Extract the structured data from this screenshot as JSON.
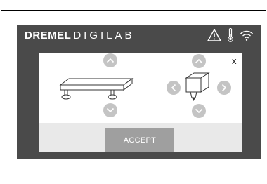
{
  "brand": {
    "bold": "DREMEL",
    "light": "DIGILAB"
  },
  "status_icons": [
    "warning-icon",
    "thermometer-icon",
    "wifi-icon"
  ],
  "dialog": {
    "close_label": "x",
    "accept_label": "ACCEPT",
    "bed_controls": [
      "arrow-up",
      "arrow-down"
    ],
    "extruder_controls": [
      "arrow-up",
      "arrow-down",
      "arrow-left",
      "arrow-right"
    ]
  },
  "colors": {
    "screen_bg": "#4a4a4a",
    "dialog_bg": "#ffffff",
    "footer_bg": "#e9e9e9",
    "accept_bg": "#9f9f9f",
    "arrow_bg": "#c4c4c4"
  }
}
